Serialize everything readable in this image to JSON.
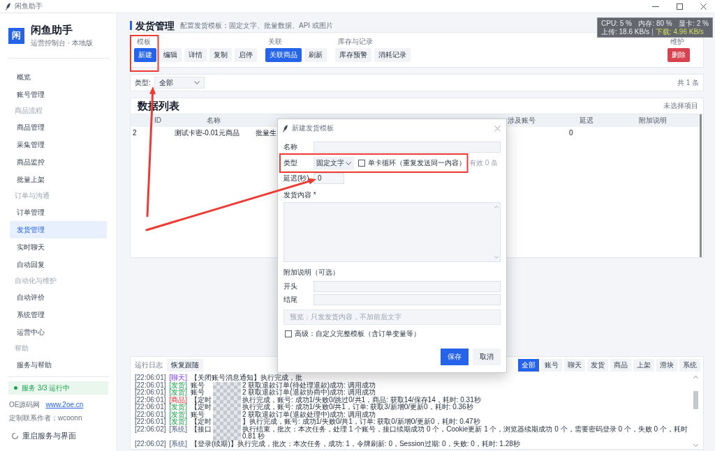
{
  "window": {
    "title": "闲鱼助手"
  },
  "sidebar": {
    "logo_char": "闲",
    "app_name": "闲鱼助手",
    "subtitle": "运营控制台 · 本地版",
    "sections": [
      {
        "items": [
          {
            "label": "概览",
            "selected": false
          },
          {
            "label": "账号管理",
            "selected": false
          }
        ]
      },
      {
        "title": "商品流程",
        "items": [
          {
            "label": "商品管理",
            "selected": false
          },
          {
            "label": "采集管理",
            "selected": false
          },
          {
            "label": "商品监控",
            "selected": false
          },
          {
            "label": "批量上架",
            "selected": false
          }
        ]
      },
      {
        "title": "订单与沟通",
        "items": [
          {
            "label": "订单管理",
            "selected": false
          },
          {
            "label": "发货管理",
            "selected": true
          },
          {
            "label": "实时聊天",
            "selected": false
          },
          {
            "label": "自动回复",
            "selected": false
          }
        ]
      },
      {
        "title": "自动化与维护",
        "items": [
          {
            "label": "自动评价",
            "selected": false
          },
          {
            "label": "系统管理",
            "selected": false
          },
          {
            "label": "运营中心",
            "selected": false
          }
        ]
      },
      {
        "title": "帮助",
        "items": [
          {
            "label": "服务与帮助",
            "selected": false
          }
        ]
      }
    ],
    "service_status": "服务 3/3 运行中",
    "source": {
      "label": "OE源码网",
      "link": "www.2oe.cn"
    },
    "contact": "定制联系作者：wcoonn",
    "restart": "重启服务与界面"
  },
  "page": {
    "title": "发货管理",
    "subtitle": "配置发货模板：固定文字、批量数据、API 或图片"
  },
  "system_monitor": {
    "cpu": "CPU: 5 %",
    "memory": "内存: 80 %",
    "gpu": "显卡: 2 %",
    "upload": "上传: 18.6 KB/s",
    "download": "下载: 4.96 KB/s"
  },
  "toolbar": {
    "groups": [
      {
        "label": "模板",
        "buttons": [
          {
            "label": "新建",
            "kind": "primary"
          },
          {
            "label": "编辑",
            "kind": "default"
          },
          {
            "label": "详情",
            "kind": "default"
          },
          {
            "label": "复制",
            "kind": "default"
          },
          {
            "label": "启停",
            "kind": "default"
          }
        ]
      },
      {
        "label": "关联",
        "buttons": [
          {
            "label": "关联商品",
            "kind": "primary"
          },
          {
            "label": "刷新",
            "kind": "default"
          }
        ]
      },
      {
        "label": "库存与记录",
        "buttons": [
          {
            "label": "库存预警",
            "kind": "default"
          },
          {
            "label": "消耗记录",
            "kind": "default"
          }
        ]
      },
      {
        "label": "维护",
        "buttons": [
          {
            "label": "删除",
            "kind": "danger"
          }
        ]
      }
    ]
  },
  "filter": {
    "label": "类型:",
    "value": "全部",
    "count": "共 1 条"
  },
  "table": {
    "title": "数据列表",
    "selection": "未选择项目",
    "columns": [
      "ID",
      "名称",
      null,
      null,
      null,
      "涉及账号",
      "延迟",
      "附加说明"
    ],
    "rows": [
      {
        "cells": [
          "2",
          "测试卡密-0.01元商品",
          "批量生",
          null,
          null,
          null,
          "0",
          null
        ]
      }
    ]
  },
  "dialog": {
    "title": "新建发货模板",
    "name": {
      "label": "名称"
    },
    "type": {
      "label": "类型",
      "value": "固定文字"
    },
    "single_loop": {
      "label": "单卡循环（重复发送同一内容）",
      "checked": false
    },
    "valid_count": "有效 0 条",
    "delay": {
      "label": "延迟(秒)",
      "value": "0"
    },
    "content": {
      "label": "发货内容 *"
    },
    "extra": {
      "title": "附加说明（可选）",
      "fields": [
        {
          "label": "开头"
        },
        {
          "label": "结尾"
        }
      ],
      "preview": "预览：只发发货内容，不加前后文字"
    },
    "advanced": {
      "label": "高级：自定义完整模板（含订单变量等）",
      "checked": false
    },
    "buttons": [
      {
        "label": "保存",
        "kind": "primary"
      },
      {
        "label": "取消",
        "kind": "default"
      }
    ]
  },
  "log": {
    "title": "运行日志",
    "follow_button": "恢复跟随",
    "filters": [
      {
        "label": "全部",
        "selected": true
      },
      {
        "label": "账号",
        "selected": false
      },
      {
        "label": "聊天",
        "selected": false
      },
      {
        "label": "发货",
        "selected": false
      },
      {
        "label": "商品",
        "selected": false
      },
      {
        "label": "上架",
        "selected": false
      },
      {
        "label": "滑块",
        "selected": false
      },
      {
        "label": "系统",
        "selected": false
      }
    ],
    "lines": [
      {
        "time": "[22:06:01]",
        "tag": "[聊天]",
        "kind": "chat",
        "text": "【关闭账号消息通知】执行完成，批",
        "masked": false
      },
      {
        "time": "[22:06:01]",
        "tag": "[发货]",
        "kind": "delivery",
        "text": "账号",
        "after": "2 获取退款订单(待处理退款)成功: 调用成功",
        "masked": true
      },
      {
        "time": "[22:06:01]",
        "tag": "[发货]",
        "kind": "delivery",
        "text": "账号",
        "after": "2 获取退款订单(退款协商中)成功: 调用成功",
        "masked": true
      },
      {
        "time": "[22:06:01]",
        "tag": "[商品]",
        "kind": "product",
        "text": "【定时",
        "after": "执行完成，账号: 成功1/失败0/跳过0/共1，商品: 获取14/保存14，耗时: 0.31秒",
        "masked": true
      },
      {
        "time": "[22:06:01]",
        "tag": "[发货]",
        "kind": "delivery",
        "text": "【定时",
        "after": "执行完成，账号: 成功1/失败0/共1，订单: 获取3/新增0/更新0，耗时: 0.36秒",
        "masked": true
      },
      {
        "time": "[22:06:01]",
        "tag": "[发货]",
        "kind": "delivery",
        "text": "账号",
        "after": "2 获取退款订单(退款处理中)成功: 调用成功",
        "masked": true
      },
      {
        "time": "[22:06:01]",
        "tag": "[发货]",
        "kind": "delivery",
        "text": "【定时",
        "after": "】执行完成，账号: 成功1/失败0/共1，订单: 获取0/新增0/更新0，耗时: 0.47秒",
        "masked": true
      },
      {
        "time": "[22:06:02]",
        "tag": "[系统]",
        "kind": "system",
        "text": "【接口",
        "after": "执行结束，批次：本次任务，处理 1 个账号，接口续期成功 0 个，Cookie更新 1 个，浏览器续期成功 0 个，需要密码登录 0 个，失败 0 个，耗时 0.81 秒",
        "masked": true
      },
      {
        "time": "[22:06:02]",
        "tag": "[系统]",
        "kind": "system",
        "text": "【登录(续期)】执行完成，批次：本次任务，成功: 1，令牌刷新: 0，Session过期: 0，失败: 0，耗时: 1.28秒",
        "masked": false
      }
    ]
  }
}
